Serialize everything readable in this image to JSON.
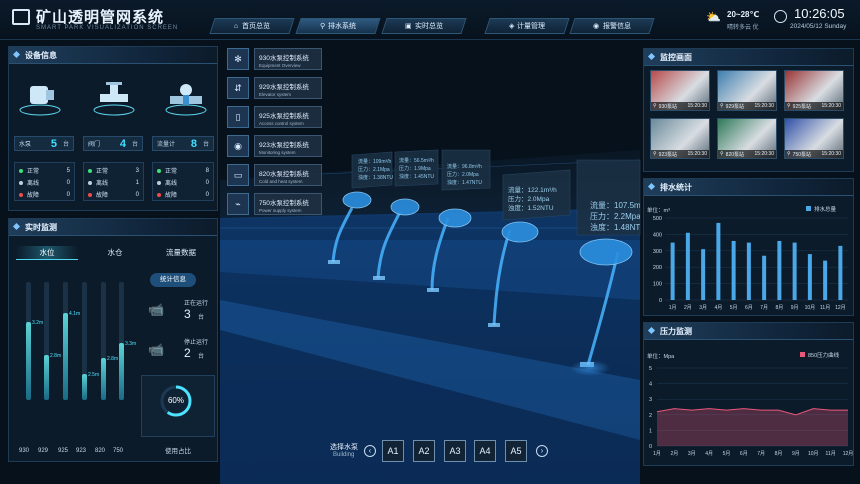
{
  "header": {
    "title": "矿山透明管网系统",
    "subtitle": "SMART PARK VISUALIZATION SCREEN",
    "nav": [
      {
        "label": "首页总览",
        "icon": "home-icon"
      },
      {
        "label": "排水系统",
        "icon": "droplet-icon"
      },
      {
        "label": "实时总览",
        "icon": "monitor-icon"
      },
      {
        "label": "计量管理",
        "icon": "shield-icon"
      },
      {
        "label": "报警信息",
        "icon": "alert-icon"
      }
    ],
    "temperature": "20~28℃",
    "weather_desc": "晴转多云 优",
    "time": "10:26:05",
    "date": "2024/05/12 Sunday"
  },
  "device_panel": {
    "title": "设备信息",
    "devices": [
      {
        "name": "水泵",
        "count": "5",
        "unit": "台",
        "normal": "5",
        "offline": "0",
        "fault": "0"
      },
      {
        "name": "阀门",
        "count": "4",
        "unit": "台",
        "normal": "3",
        "offline": "1",
        "fault": "0"
      },
      {
        "name": "流量计",
        "count": "8",
        "unit": "台",
        "normal": "8",
        "offline": "0",
        "fault": "0"
      }
    ],
    "labels": {
      "normal": "正常",
      "offline": "离线",
      "fault": "故障"
    }
  },
  "monitor_panel": {
    "title": "实时监测",
    "tabs": [
      "水位",
      "水仓",
      "流量数据"
    ],
    "bars": [
      {
        "x": "930",
        "level": 0.66,
        "label": "3.2m"
      },
      {
        "x": "929",
        "level": 0.38,
        "label": ""
      },
      {
        "x": "925",
        "level": 0.74,
        "label": "4.1m"
      },
      {
        "x": "923",
        "level": 0.22,
        "label": "2.5m"
      },
      {
        "x": "820",
        "level": 0.36,
        "label": "2.8m"
      },
      {
        "x": "750",
        "level": 0.48,
        "label": "3.3m"
      }
    ],
    "bar_label_929": "2.8m",
    "stats_title": "统计信息",
    "running_label": "正在运行",
    "running_value": "3",
    "stopped_label": "停止运行",
    "stopped_value": "2",
    "unit": "台",
    "usage_percent": "60%",
    "usage_level": 0.6,
    "usage_label": "使用占比"
  },
  "pumps": [
    {
      "name": "930水泵控制系统",
      "sub": "Equipment Overview",
      "icon": "snowflake-icon"
    },
    {
      "name": "929水泵控制系统",
      "sub": "Elevator system",
      "icon": "elevator-icon"
    },
    {
      "name": "925水泵控制系统",
      "sub": "Access control system",
      "icon": "door-icon"
    },
    {
      "name": "923水泵控制系统",
      "sub": "Monitoring system",
      "icon": "camera-icon"
    },
    {
      "name": "820水泵控制系统",
      "sub": "Cold and heat  system",
      "icon": "ac-icon"
    },
    {
      "name": "750水泵控制系统",
      "sub": "Power supply system",
      "icon": "power-icon"
    }
  ],
  "readouts": [
    [
      "流量：109m³/h",
      "压力：2.1Mpa",
      "浊度：1.38NTU"
    ],
    [
      "流量：56.5m³/h",
      "压力：1.9Mpa",
      "浊度：1.45NTU"
    ],
    [
      "流量：96.8m³/h",
      "压力：2.0Mpa",
      "浊度：1.47NTU"
    ],
    [
      "流量：122.1m³/h",
      "压力：2.0Mpa",
      "浊度：1.52NTU"
    ],
    [
      "流量：107.5m³/h",
      "压力：2.2Mpa",
      "浊度：1.48NTU"
    ]
  ],
  "building_selector": {
    "label": "选择水泵",
    "sub": "Building",
    "options": [
      "A1",
      "A2",
      "A3",
      "A4",
      "A5"
    ]
  },
  "camera_panel": {
    "title": "监控画面",
    "cams": [
      {
        "name": "930泵站",
        "time": "15:20:30",
        "color": "#b84a4a"
      },
      {
        "name": "929泵站",
        "time": "15:20:30",
        "color": "#3f7fb0"
      },
      {
        "name": "925泵站",
        "time": "15:20:30",
        "color": "#9a3434"
      },
      {
        "name": "923泵站",
        "time": "15:20:30",
        "color": "#6a8a9a"
      },
      {
        "name": "820泵站",
        "time": "15:20:30",
        "color": "#2f7a5a"
      },
      {
        "name": "750泵站",
        "time": "15:20:30",
        "color": "#3050a8"
      }
    ]
  },
  "drain_chart": {
    "title": "排水统计",
    "unit": "单位：m³",
    "chart_data": {
      "type": "bar",
      "categories": [
        "1月",
        "2月",
        "3月",
        "4月",
        "5月",
        "6月",
        "7月",
        "8月",
        "9月",
        "10月",
        "11月",
        "12月"
      ],
      "series": [
        {
          "name": "排水总量",
          "values": [
            350,
            410,
            310,
            470,
            360,
            350,
            270,
            360,
            350,
            280,
            240,
            330
          ]
        }
      ],
      "ylim": [
        0,
        500
      ],
      "yticks": [
        0,
        100,
        200,
        300,
        400,
        500
      ],
      "color": "#4aa8e8"
    }
  },
  "pressure_chart": {
    "title": "压力监测",
    "unit": "单位：Mpa",
    "chart_data": {
      "type": "area",
      "categories": [
        "1月",
        "2月",
        "3月",
        "4月",
        "5月",
        "6月",
        "7月",
        "8月",
        "9月",
        "10月",
        "11月",
        "12月"
      ],
      "series": [
        {
          "name": "850压力曲线",
          "values": [
            2.2,
            2.4,
            2.3,
            2.4,
            2.3,
            2.4,
            2.3,
            2.3,
            2.0,
            2.4,
            2.3,
            2.3
          ]
        }
      ],
      "ylim": [
        0,
        5
      ],
      "yticks": [
        0,
        1,
        2,
        3,
        4,
        5
      ],
      "color": "#e8587a"
    }
  }
}
